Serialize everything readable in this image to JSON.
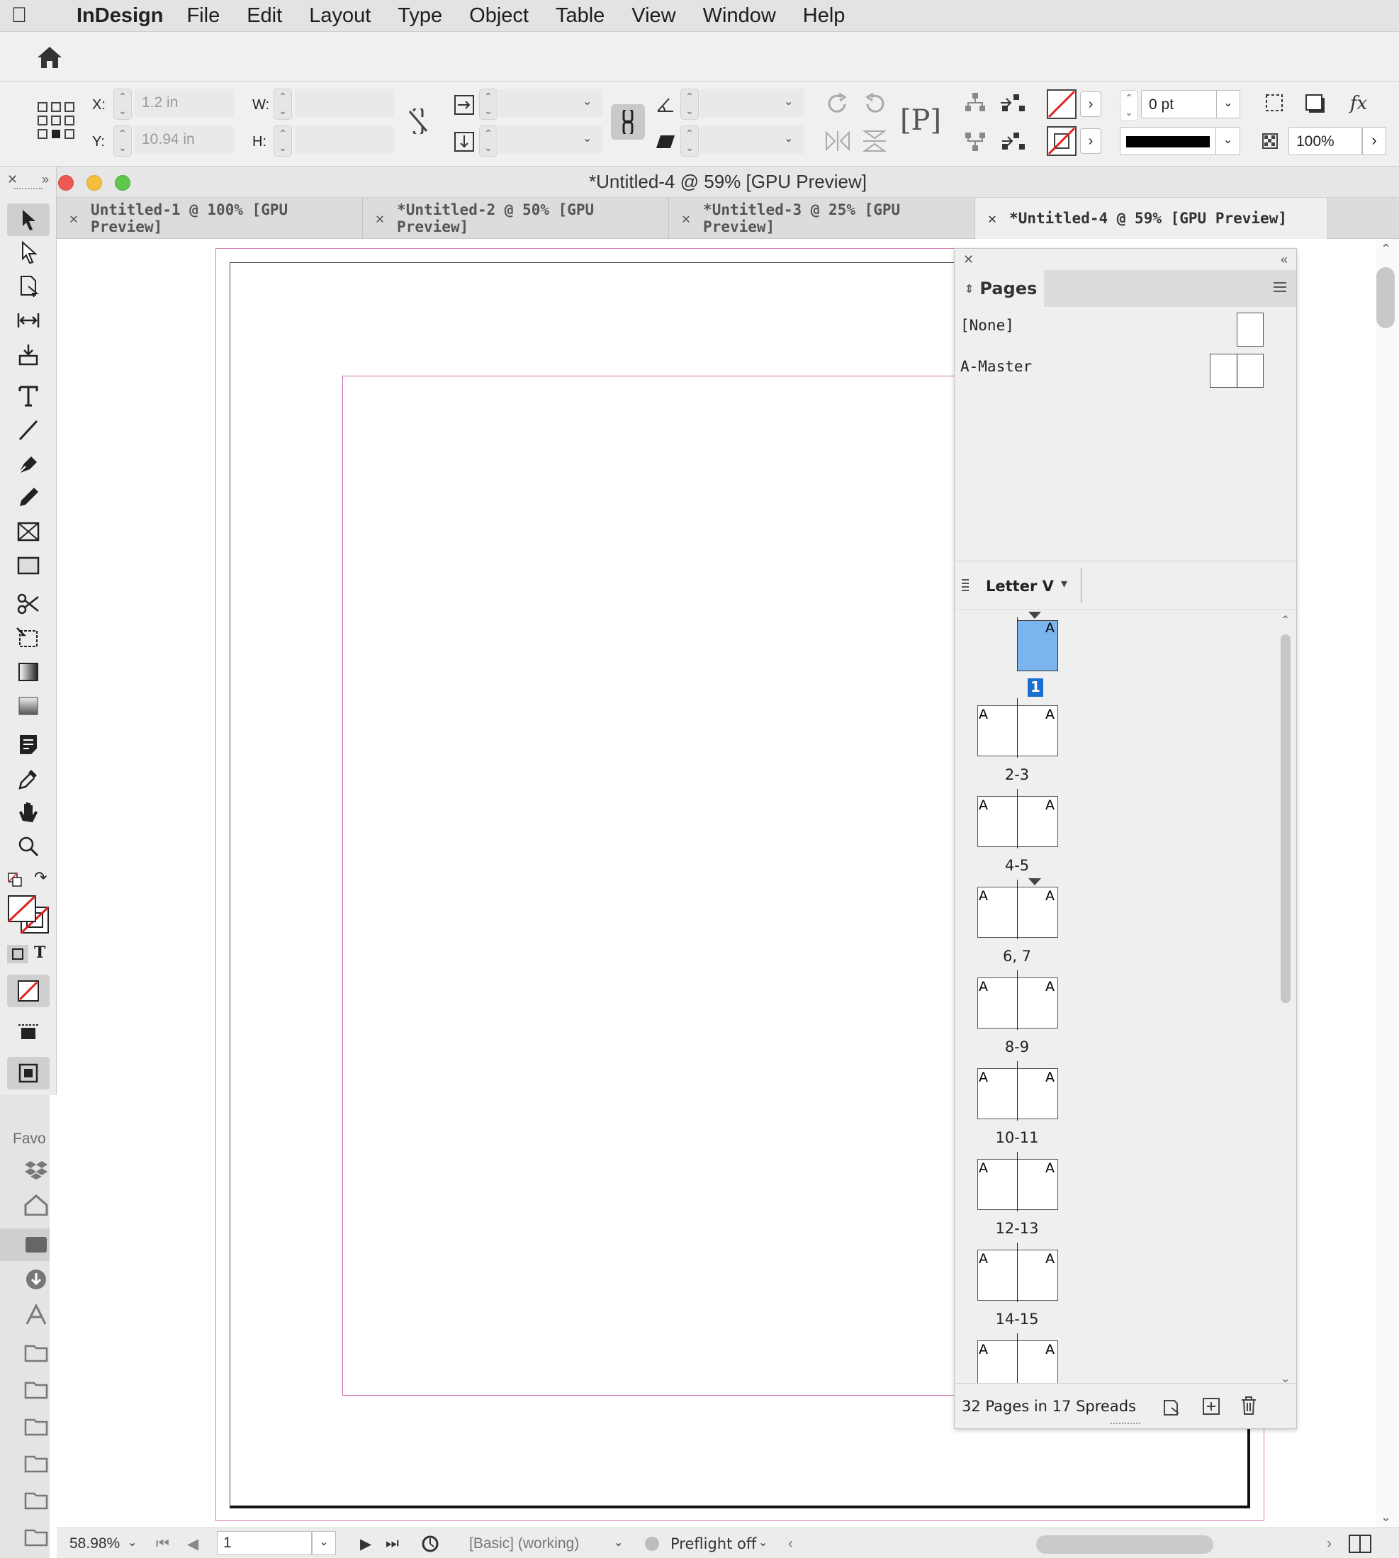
{
  "menubar": {
    "app_name": "InDesign",
    "items": [
      "File",
      "Edit",
      "Layout",
      "Type",
      "Object",
      "Table",
      "View",
      "Window",
      "Help"
    ]
  },
  "control": {
    "x_label": "X:",
    "x_value": "1.2 in",
    "y_label": "Y:",
    "y_value": "10.94 in",
    "w_label": "W:",
    "h_label": "H:",
    "stroke_weight": "0 pt",
    "opacity": "100%"
  },
  "window": {
    "title": "*Untitled-4 @ 59% [GPU Preview]",
    "tabs": [
      {
        "label": "Untitled-1 @ 100% [GPU Preview]"
      },
      {
        "label": "*Untitled-2 @ 50% [GPU Preview]"
      },
      {
        "label": "*Untitled-3 @ 25% [GPU Preview]"
      },
      {
        "label": "*Untitled-4 @ 59% [GPU Preview]"
      }
    ]
  },
  "favorites": {
    "label": "Favo"
  },
  "pages_panel": {
    "tab_label": "Pages",
    "masters": [
      "[None]",
      "A-Master"
    ],
    "page_size": "Letter V",
    "master_letter": "A",
    "spreads": [
      "1",
      "2-3",
      "4-5",
      "6, 7",
      "8-9",
      "10-11",
      "12-13",
      "14-15"
    ],
    "footer": "32 Pages in 17 Spreads"
  },
  "status": {
    "zoom": "58.98%",
    "page": "1",
    "style": "[Basic] (working)",
    "preflight": "Preflight off"
  },
  "colors": {
    "accent": "#1a6fd1",
    "selected_page": "#7bb5ef",
    "margin_guide": "#c96aa8"
  }
}
